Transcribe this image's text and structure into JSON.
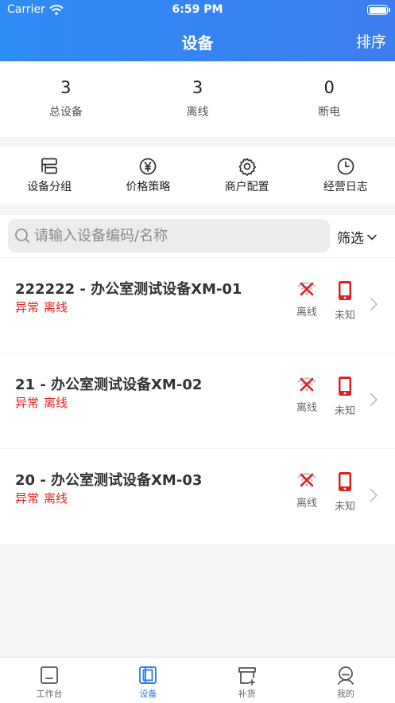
{
  "status_bar": {
    "carrier": "Carrier",
    "time": "6:59 PM"
  },
  "nav": {
    "title": "设备",
    "sort_label": "排序"
  },
  "stats": [
    {
      "value": "3",
      "label": "总设备"
    },
    {
      "value": "3",
      "label": "离线"
    },
    {
      "value": "0",
      "label": "断电"
    }
  ],
  "quick_actions": [
    {
      "label": "设备分组",
      "icon": "group-icon"
    },
    {
      "label": "价格策略",
      "icon": "yen-icon"
    },
    {
      "label": "商户配置",
      "icon": "gear-icon"
    },
    {
      "label": "经营日志",
      "icon": "clock-icon"
    }
  ],
  "search": {
    "placeholder": "请输入设备编码/名称",
    "value": ""
  },
  "filter_label": "筛选",
  "devices": [
    {
      "title": "222222 - 办公室测试设备XM-01",
      "tag_abnormal": "异常",
      "tag_offline": "离线",
      "network_status": "离线",
      "power_status": "未知"
    },
    {
      "title": "21 - 办公室测试设备XM-02",
      "tag_abnormal": "异常",
      "tag_offline": "离线",
      "network_status": "离线",
      "power_status": "未知"
    },
    {
      "title": "20 - 办公室测试设备XM-03",
      "tag_abnormal": "异常",
      "tag_offline": "离线",
      "network_status": "离线",
      "power_status": "未知"
    }
  ],
  "tabs": [
    {
      "label": "工作台",
      "icon": "workbench-icon",
      "active": false
    },
    {
      "label": "设备",
      "icon": "device-icon",
      "active": true
    },
    {
      "label": "补货",
      "icon": "restock-icon",
      "active": false
    },
    {
      "label": "我的",
      "icon": "profile-icon",
      "active": false
    }
  ],
  "colors": {
    "primary": "#2f7ff0",
    "alert": "#e02020",
    "background": "#f5f5f7"
  }
}
